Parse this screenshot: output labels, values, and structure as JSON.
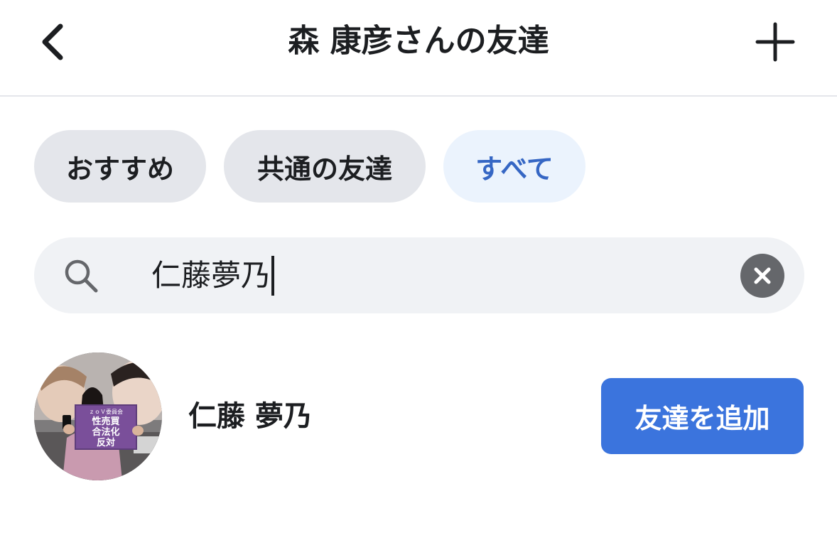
{
  "header": {
    "title": "森 康彦さんの友達",
    "back_icon": "chevron-left-icon",
    "add_icon": "plus-icon"
  },
  "tabs": [
    {
      "label": "おすすめ",
      "selected": false
    },
    {
      "label": "共通の友達",
      "selected": false
    },
    {
      "label": "すべて",
      "selected": true
    }
  ],
  "search": {
    "value": "仁藤夢乃",
    "search_icon": "search-icon",
    "clear_icon": "clear-icon"
  },
  "results": [
    {
      "name": "仁藤 夢乃",
      "action_label": "友達を追加",
      "avatar_sign_top": "ｚｏＶ委員会",
      "avatar_sign_lines": [
        "性売買",
        "合法化",
        "反対"
      ]
    }
  ],
  "colors": {
    "accent": "#3b74dd",
    "selected_tab_bg": "#ebf3fd",
    "selected_tab_text": "#3566c4",
    "chip_bg": "#e4e6eb",
    "search_bg": "#f0f2f5"
  }
}
